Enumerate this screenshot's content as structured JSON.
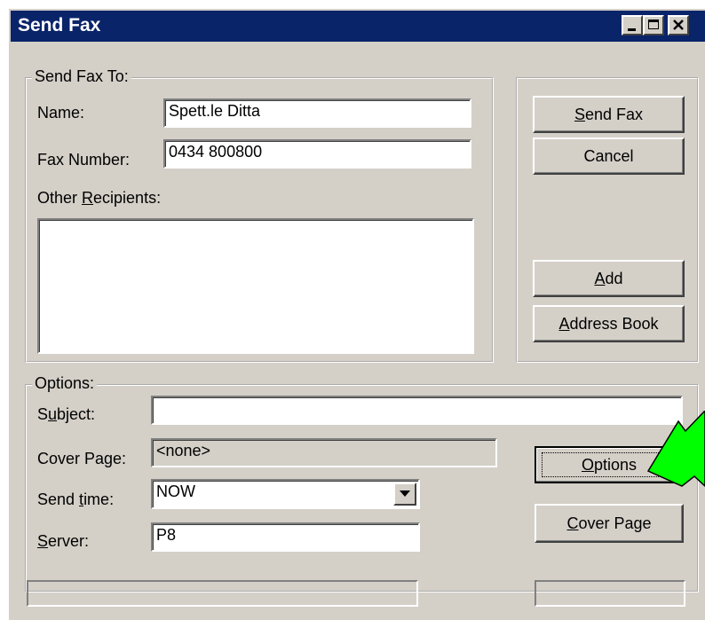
{
  "window": {
    "title": "Send Fax"
  },
  "send_fax_to": {
    "legend": "Send Fax To:",
    "name_label_pre": "Name:",
    "name_value": "Spett.le Ditta",
    "fax_label": "Fax Number:",
    "fax_value": "0434 800800",
    "other_pre": "Other ",
    "other_key": "R",
    "other_post": "ecipients:",
    "other_value": ""
  },
  "buttons": {
    "send_fax_key": "S",
    "send_fax_rest": "end Fax",
    "cancel": "Cancel",
    "add_key": "A",
    "add_rest": "dd",
    "address_key": "A",
    "address_rest": "ddress Book",
    "options_key": "O",
    "options_rest": "ptions",
    "cover_key": "C",
    "cover_rest": "over Page"
  },
  "options": {
    "legend": "Options:",
    "subject_pre": "S",
    "subject_key": "u",
    "subject_post": "bject:",
    "subject_value": "",
    "cover_label": "Cover Page:",
    "cover_value": "<none>",
    "send_time_pre": "Send ",
    "send_time_key": "t",
    "send_time_post": "ime:",
    "send_time_value": "NOW",
    "server_key": "S",
    "server_post": "erver:",
    "server_value": "P8"
  },
  "colors": {
    "titlebar": "#0a246a",
    "face": "#d4d0c8",
    "arrow": "#00ff00"
  }
}
